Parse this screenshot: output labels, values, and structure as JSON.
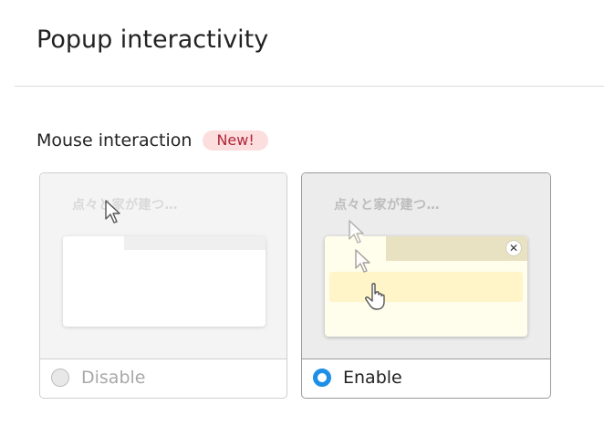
{
  "page": {
    "title": "Popup interactivity"
  },
  "section": {
    "label": "Mouse interaction",
    "badge": "New!"
  },
  "options": [
    {
      "label": "Disable",
      "selected": false,
      "sample_text": "点々と家が建つ…"
    },
    {
      "label": "Enable",
      "selected": true,
      "sample_text": "点々と家が建つ…"
    }
  ],
  "icons": {
    "arrow_cursor": "arrow-cursor-icon",
    "hand_cursor": "hand-cursor-icon",
    "close": "close-icon",
    "radio": "radio-icon"
  },
  "colors": {
    "accent": "#1e8fe6",
    "badge_bg": "#fddede",
    "badge_text": "#b0263a",
    "popup_bg": "#fffdeb",
    "popup_bar": "#fff5c8"
  }
}
